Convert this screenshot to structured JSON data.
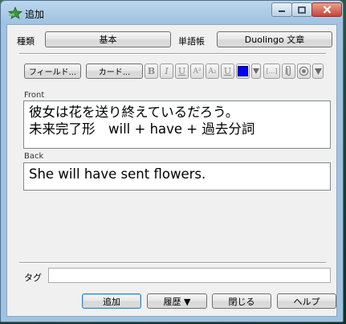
{
  "window": {
    "title": "追加"
  },
  "note_type": {
    "label": "種類",
    "value": "基本"
  },
  "deck": {
    "label": "単語帳",
    "value": "Duolingo 文章"
  },
  "toolbar": {
    "fields_button": "フィールド...",
    "cards_button": "カード...",
    "bold": "B",
    "italic": "I",
    "underline": "U",
    "superscript": "A²",
    "subscript": "A₂",
    "clear_format": "U",
    "text_color": "#0000ff",
    "cloze": "[...]"
  },
  "fields": [
    {
      "name": "Front",
      "lines": [
        "彼女は花を送り終えているだろう。",
        "未来完了形　will + have + 過去分詞"
      ]
    },
    {
      "name": "Back",
      "lines": [
        "She will have sent flowers."
      ]
    }
  ],
  "tags": {
    "label": "タグ",
    "value": ""
  },
  "buttons": {
    "add": "追加",
    "history": "履歴 ▼",
    "close": "閉じる",
    "help": "ヘルプ"
  }
}
